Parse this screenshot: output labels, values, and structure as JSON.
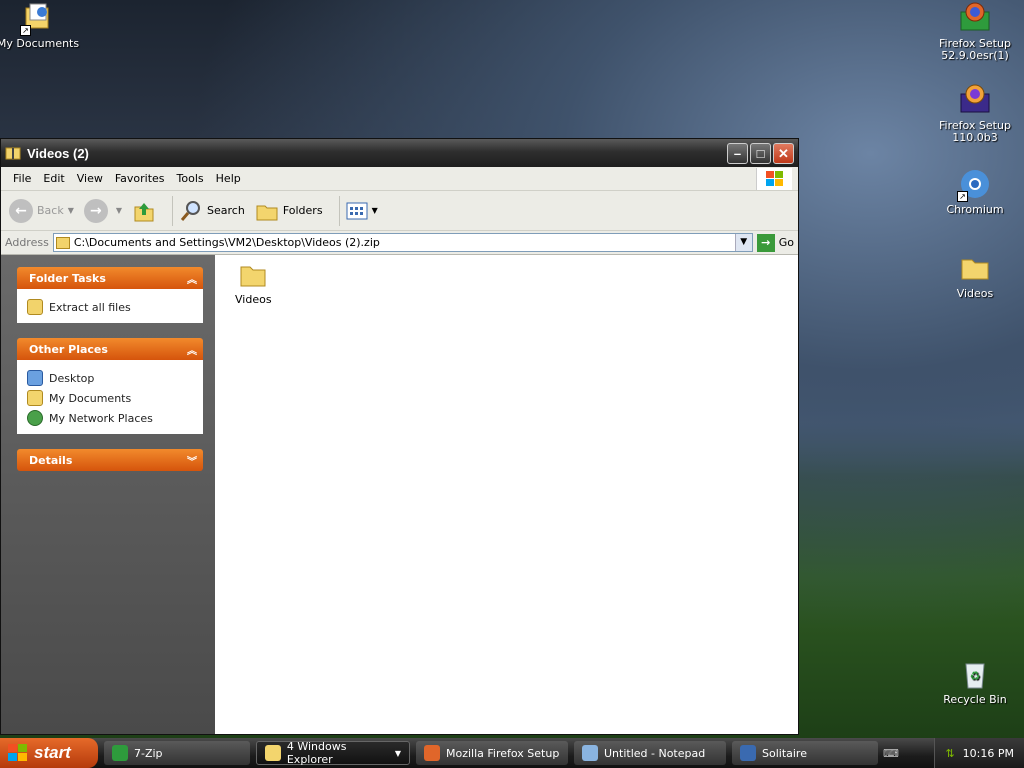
{
  "desktop": {
    "icons": [
      {
        "label": "My Documents"
      },
      {
        "label": "Firefox Setup 52.9.0esr(1)"
      },
      {
        "label": "Firefox Setup 110.0b3"
      },
      {
        "label": "Chromium"
      },
      {
        "label": "Videos"
      },
      {
        "label": "Recycle Bin"
      }
    ]
  },
  "window": {
    "title": "Videos (2)",
    "menu": [
      "File",
      "Edit",
      "View",
      "Favorites",
      "Tools",
      "Help"
    ],
    "toolbar": {
      "back": "Back",
      "search": "Search",
      "folders": "Folders"
    },
    "address": {
      "label": "Address",
      "value": "C:\\Documents and Settings\\VM2\\Desktop\\Videos (2).zip",
      "go": "Go"
    },
    "folder_tasks": {
      "title": "Folder Tasks",
      "items": [
        "Extract all files"
      ]
    },
    "other_places": {
      "title": "Other Places",
      "items": [
        "Desktop",
        "My Documents",
        "My Network Places"
      ]
    },
    "details": {
      "title": "Details"
    },
    "files": [
      {
        "name": "Videos"
      }
    ]
  },
  "taskbar": {
    "start": "start",
    "buttons": [
      "7-Zip",
      "4 Windows Explorer",
      "Mozilla Firefox Setup",
      "Untitled - Notepad",
      "Solitaire"
    ],
    "clock": "10:16 PM"
  }
}
